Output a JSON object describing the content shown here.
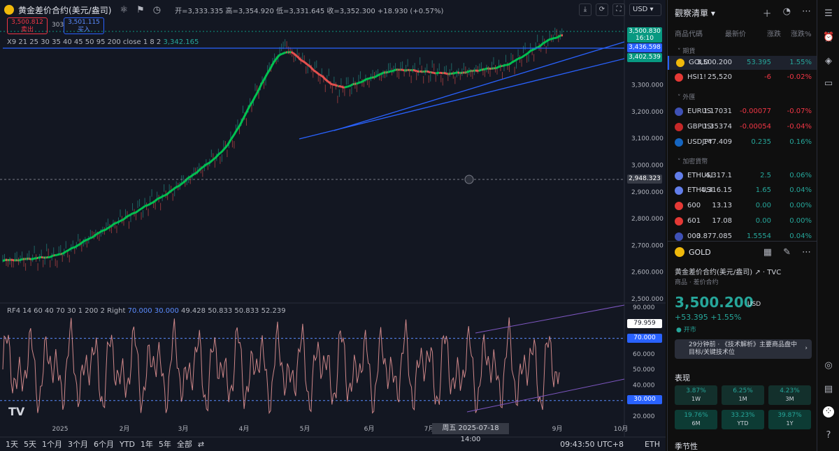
{
  "chart": {
    "symbol_title": "黄金差价合约(美元/盎司)",
    "ohlc": "开=3,333.335 高=3,354.920 低=3,331.645 收=3,352.300 +18.930 (+0.57%)",
    "sell_price": "3,500.812",
    "sell_label": "卖出",
    "buy_price": "3,501.115",
    "buy_label": "买入",
    "spread": "303",
    "currency": "USD",
    "ma_label": "X9 21 25 30 35 40 45 50 95 200 close 1 8 2",
    "ma_value": "3,342.165",
    "osc_label": "RF4 14 60 40 70 30 1 200 2 Right",
    "osc_vals": {
      "v1": "70.000",
      "v2": "30.000",
      "v3": "49.428",
      "v4": "50.833",
      "v5": "50.833",
      "v6": "52.239"
    },
    "price_ticks": [
      "3,300.000",
      "3,200.000",
      "3,100.000",
      "3,000.000",
      "2,900.000",
      "2,800.000",
      "2,700.000",
      "2,600.000",
      "2,500.000"
    ],
    "osc_ticks": [
      "90.000",
      "80.000",
      "70.000",
      "60.000",
      "50.000",
      "40.000",
      "30.000",
      "20.000"
    ],
    "price_tags": {
      "last": "3,500.830",
      "countdown": "16:10",
      "hline": "3,436.598",
      "ma": "3,402.539",
      "cross": "2,948.323",
      "osc_last": "79.959",
      "osc_70": "70.000",
      "osc_30": "30.000"
    },
    "x_labels": [
      "2025",
      "2月",
      "3月",
      "4月",
      "5月",
      "6月",
      "7月",
      "9月",
      "10月"
    ],
    "date_tag": "周五 2025-07-18   14:00",
    "timeframes": [
      "1天",
      "5天",
      "1个月",
      "3个月",
      "6个月",
      "YTD",
      "1年",
      "5年",
      "全部"
    ],
    "clock": "09:43:50 UTC+8",
    "session": "ETH",
    "tv_logo": "TV"
  },
  "chart_data": {
    "type": "line",
    "x": [
      "2024-12",
      "2025-01",
      "2025-02",
      "2025-03",
      "2025-04",
      "2025-04-22",
      "2025-05",
      "2025-06",
      "2025-07",
      "2025-08",
      "2025-09-01"
    ],
    "series": [
      {
        "values": [
          2640,
          2660,
          2780,
          2900,
          3060,
          3450,
          3280,
          3360,
          3340,
          3370,
          3500
        ]
      }
    ],
    "ylim": [
      2500,
      3500
    ]
  },
  "watchlist": {
    "title": "觀察清單",
    "columns": [
      "商品代碼",
      "最新价",
      "涨跌",
      "涨跌%"
    ],
    "sections": [
      "期貨",
      "外匯",
      "加密貨幣"
    ],
    "rows": [
      {
        "sym": "GOLD",
        "last": "3,500.200",
        "chg": "53.395",
        "pct": "1.55%",
        "dir": "up",
        "color": "#f0b90b"
      },
      {
        "sym": "HSI1!",
        "last": "25,520",
        "chg": "-6",
        "pct": "-0.02%",
        "dir": "dn",
        "color": "#e53935"
      },
      {
        "sym": "EURUSD",
        "last": "1.17031",
        "chg": "-0.00077",
        "pct": "-0.07%",
        "dir": "dn",
        "color": "#3f51b5"
      },
      {
        "sym": "GBPUSD",
        "last": "1.35374",
        "chg": "-0.00054",
        "pct": "-0.04%",
        "dir": "dn",
        "color": "#c62828"
      },
      {
        "sym": "USDJPY",
        "last": "147.409",
        "chg": "0.235",
        "pct": "0.16%",
        "dir": "up",
        "color": "#1565c0"
      },
      {
        "sym": "ETHUSD",
        "last": "4,317.1",
        "chg": "2.5",
        "pct": "0.06%",
        "dir": "up",
        "color": "#627eea"
      },
      {
        "sym": "ETHUSD",
        "last": "4,316.15",
        "chg": "1.65",
        "pct": "0.04%",
        "dir": "up",
        "color": "#627eea"
      },
      {
        "sym": "600",
        "last": "13.13",
        "chg": "0.00",
        "pct": "0.00%",
        "dir": "up",
        "color": "#e53935"
      },
      {
        "sym": "601",
        "last": "17.08",
        "chg": "0.00",
        "pct": "0.00%",
        "dir": "up",
        "color": "#e53935"
      },
      {
        "sym": "000",
        "last": "3.877.085",
        "chg": "1.5554",
        "pct": "0.04%",
        "dir": "up",
        "color": "#3f51b5"
      }
    ]
  },
  "detail": {
    "symbol": "GOLD",
    "name": "黄金差价合约(美元/盎司)",
    "exchange": "TVC",
    "sub": "商品 · 差价合约",
    "price": "3,500.200",
    "currency": "USD",
    "change": "+53.395  +1.55%",
    "status": "● 开市",
    "news": "29分钟前 · 《技术解析》主要商品盘中目标/关键技术位",
    "perf_title": "表现",
    "perf": [
      {
        "v": "3.87%",
        "l": "1W"
      },
      {
        "v": "6.25%",
        "l": "1M"
      },
      {
        "v": "4.23%",
        "l": "3M"
      },
      {
        "v": "19.76%",
        "l": "6M"
      },
      {
        "v": "33.23%",
        "l": "YTD"
      },
      {
        "v": "39.87%",
        "l": "1Y"
      }
    ],
    "season_title": "季节性"
  }
}
